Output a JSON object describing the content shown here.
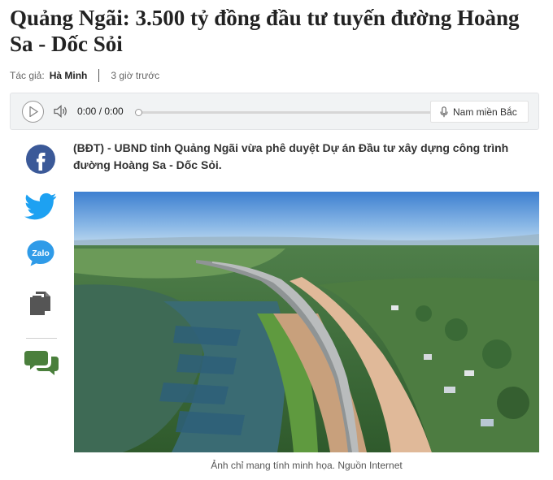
{
  "article": {
    "title": "Quảng Ngãi: 3.500 tỷ đồng đầu tư tuyến đường Hoàng Sa - Dốc Sỏi",
    "author_label": "Tác giả:",
    "author": "Hà Minh",
    "time": "3 giờ trước",
    "sapo": "(BĐT) - UBND tỉnh Quảng Ngãi vừa phê duyệt Dự án Đầu tư xây dựng công trình đường Hoàng Sa - Dốc Sỏi.",
    "caption": "Ảnh chỉ mang tính minh họa. Nguồn Internet"
  },
  "player": {
    "time": "0:00 / 0:00",
    "voice": "Nam miền Bắc",
    "progress": 0,
    "icons": {
      "play": "play-icon",
      "volume": "volume-icon",
      "mic": "microphone-icon"
    }
  },
  "share": {
    "icons": [
      "facebook-icon",
      "twitter-icon",
      "zalo-icon",
      "copy-icon",
      "comment-icon"
    ],
    "zalo_text": "Zalo"
  },
  "colors": {
    "facebook": "#3b5998",
    "twitter": "#1da1f2",
    "zalo": "#2f9be8",
    "icon_gray": "#555555",
    "comment": "#4a7f3c"
  }
}
